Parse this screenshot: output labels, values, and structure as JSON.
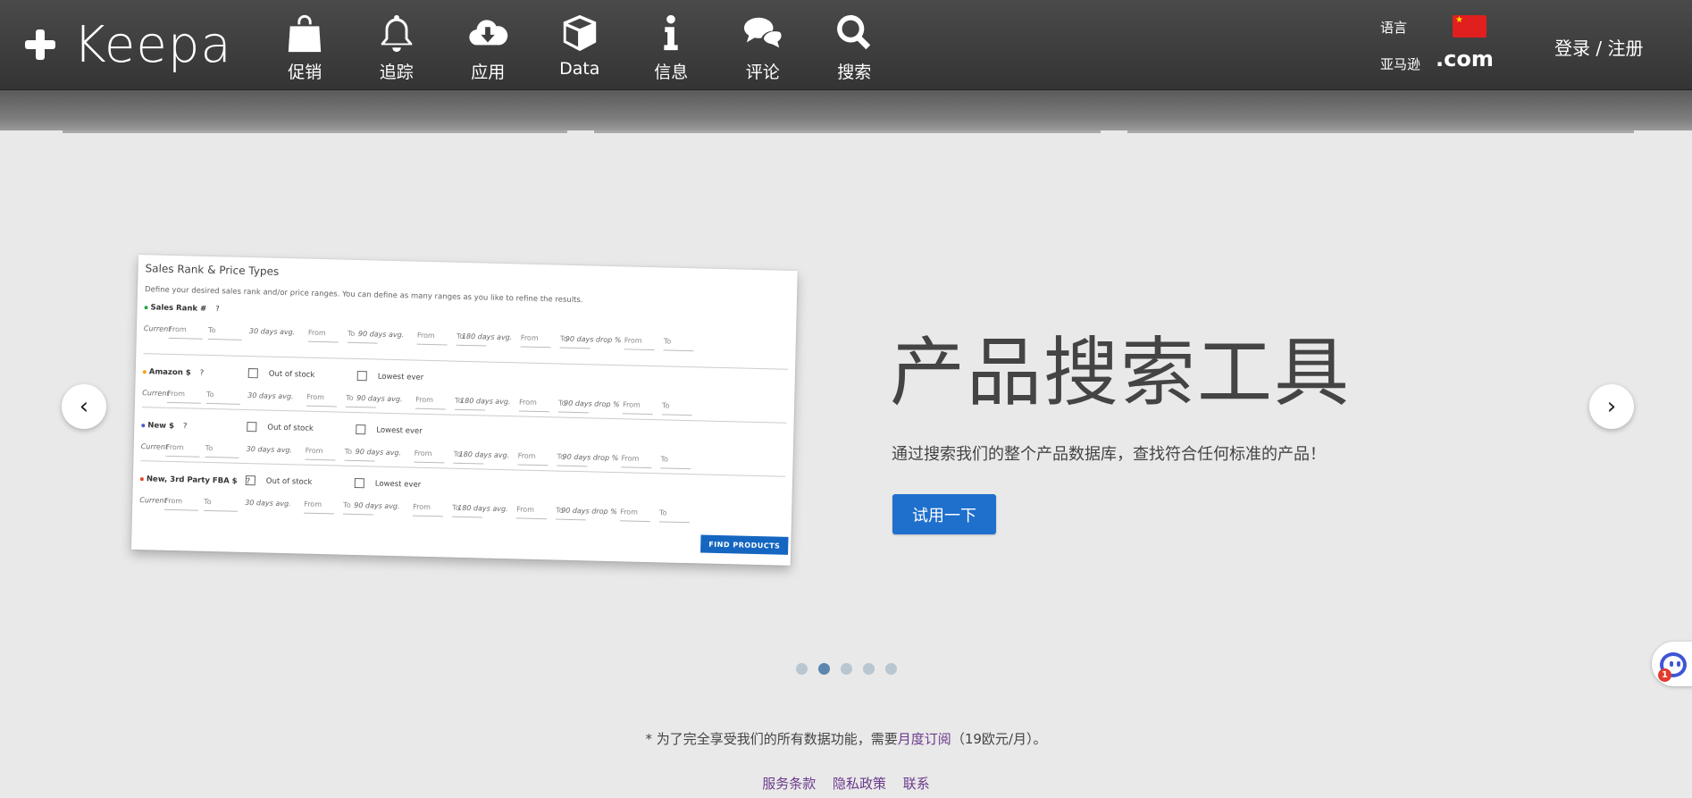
{
  "header": {
    "logo_text": "Keepa",
    "nav": [
      {
        "icon": "shopping-bag-icon",
        "label": "促销"
      },
      {
        "icon": "bell-icon",
        "label": "追踪"
      },
      {
        "icon": "cloud-download-icon",
        "label": "应用"
      },
      {
        "icon": "box-icon",
        "label": "Data"
      },
      {
        "icon": "info-icon",
        "label": "信息"
      },
      {
        "icon": "comments-icon",
        "label": "评论"
      },
      {
        "icon": "search-icon",
        "label": "搜索"
      }
    ],
    "language_label": "语言",
    "amazon_label": "亚马逊",
    "amazon_domain": ".com",
    "login_label": "登录 / 注册"
  },
  "slide": {
    "title": "产品搜索工具",
    "description": "通过搜索我们的整个产品数据库，查找符合任何标准的产品！",
    "button_label": "试用一下",
    "total_slides": 5,
    "active_slide": 2
  },
  "mockup": {
    "title": "Sales Rank & Price Types",
    "description": "Define your desired sales rank and/or price ranges. You can define as many ranges as you like to refine the results.",
    "sections": [
      {
        "name": "Sales Rank #",
        "q": "?",
        "color": "#2aa84a"
      },
      {
        "name": "Amazon $",
        "q": "?",
        "color": "#ff9a1a",
        "check1": "Out of stock",
        "check2": "Lowest ever"
      },
      {
        "name": "New $",
        "q": "?",
        "color": "#4a5bd0",
        "check1": "Out of stock",
        "check2": "Lowest ever"
      },
      {
        "name": "New, 3rd Party FBA $",
        "q": "?",
        "color": "#e04a2a",
        "check1": "Out of stock",
        "check2": "Lowest ever"
      }
    ],
    "row_labels": [
      "Current",
      "30 days avg.",
      "90 days avg.",
      "180 days avg.",
      "90 days drop %"
    ],
    "from": "From",
    "to": "To",
    "find_button": "FIND PRODUCTS"
  },
  "footer": {
    "note_prefix": "* 为了完全享受我们的所有数据功能，需要",
    "note_link": "月度订阅",
    "note_suffix": "（19欧元/月）。",
    "links": [
      "服务条款",
      "隐私政策",
      "联系"
    ]
  },
  "chat": {
    "badge": "1"
  }
}
